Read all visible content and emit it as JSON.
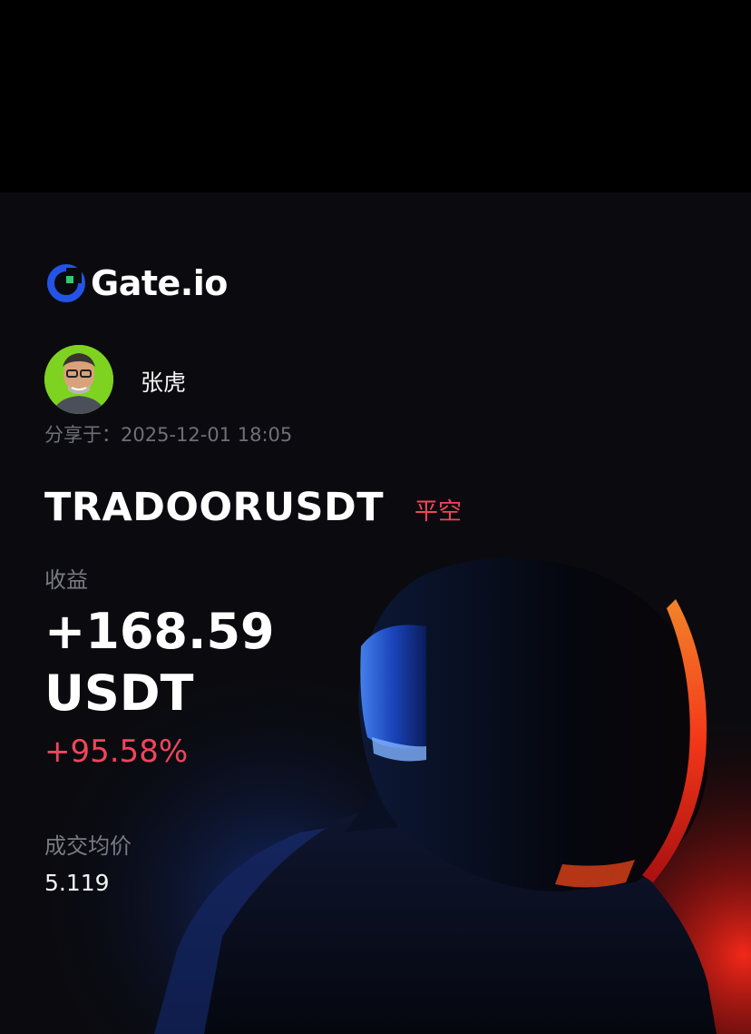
{
  "brand": {
    "name": "Gate.io",
    "logo_color": "#2354e6"
  },
  "user": {
    "name": "张虎",
    "avatar_bg": "#7ed321"
  },
  "share": {
    "label_and_time": "分享于：2025-12-01 18:05"
  },
  "trade": {
    "pair": "TRADOORUSDT",
    "side": "平空",
    "pnl_label": "收益",
    "pnl_amount": "+168.59",
    "pnl_unit": "USDT",
    "pnl_percent": "+95.58%",
    "avg_price_label": "成交均价",
    "avg_price": "5.119"
  },
  "colors": {
    "profit": "#f0455b",
    "muted": "#7a7a83",
    "background": "#0b0b0f"
  }
}
